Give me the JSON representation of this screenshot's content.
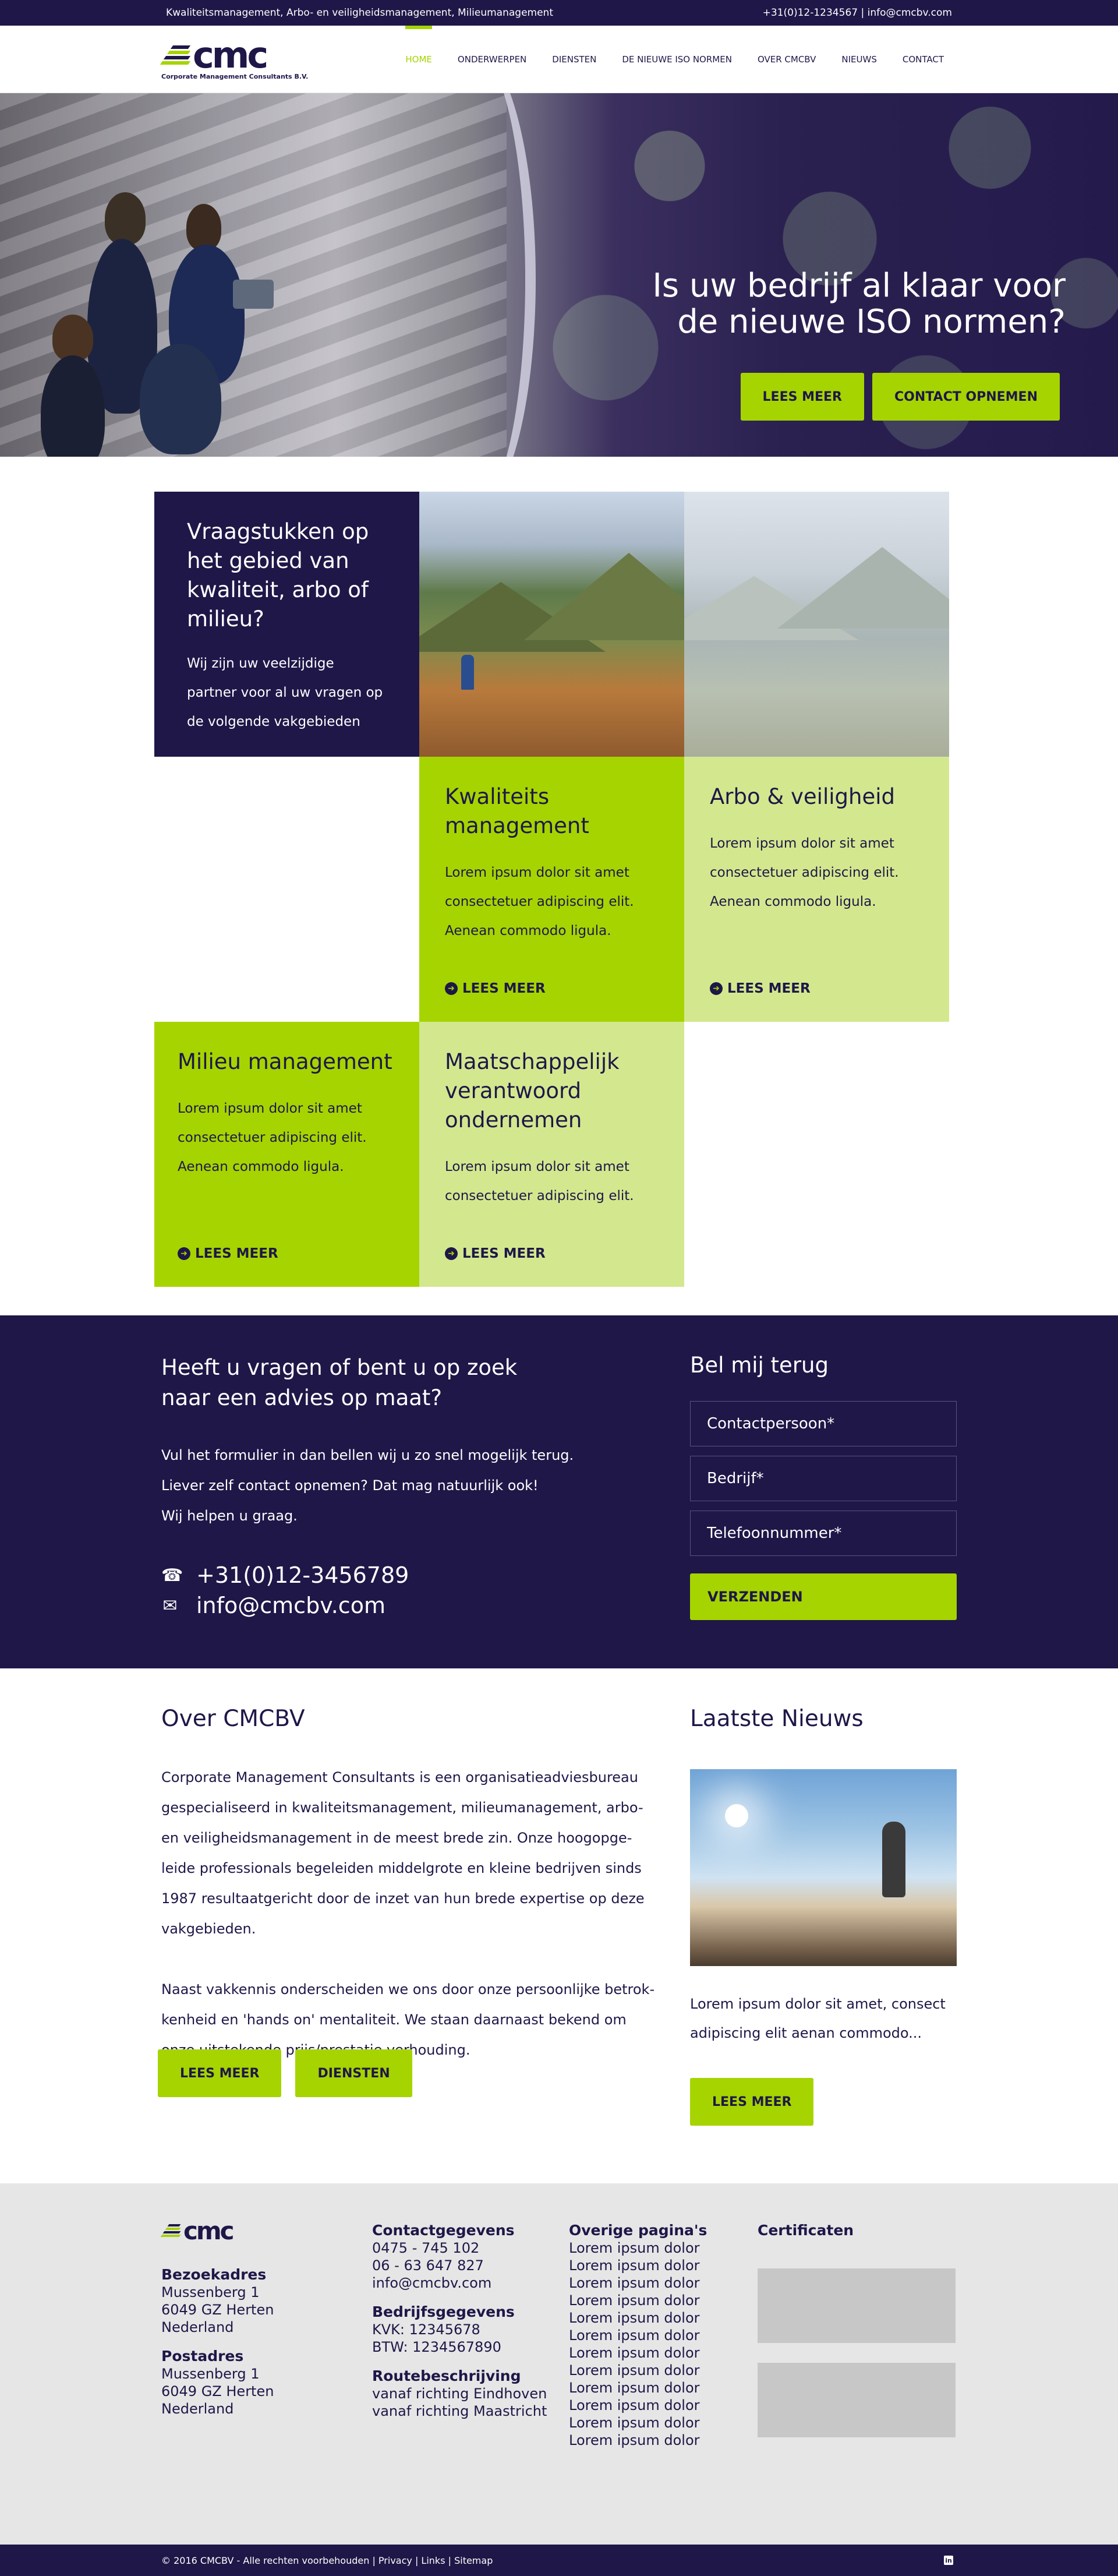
{
  "topbar": {
    "tagline": "Kwaliteitsmanagement, Arbo- en veiligheidsmanagement, Milieumanagement",
    "contact": "+31(0)12-1234567 | info@cmcbv.com"
  },
  "logo": {
    "text": "cmc",
    "subtitle": "Corporate Management Consultants B.V."
  },
  "nav": [
    "HOME",
    "ONDERWERPEN",
    "DIENSTEN",
    "DE NIEUWE ISO NORMEN",
    "OVER CMCBV",
    "NIEUWS",
    "CONTACT"
  ],
  "hero": {
    "title_line1": "Is uw bedrijf al klaar voor",
    "title_line2": "de nieuwe ISO normen?",
    "btn_more": "LEES MEER",
    "btn_contact": "CONTACT OPNEMEN"
  },
  "services": {
    "intro_title": "Vraagstukken op het gebied van kwaliteit, arbo of milieu?",
    "intro_text": "Wij zijn uw veelzijdige partner voor al uw vragen op de volgende vakgebieden",
    "more_label": "LEES MEER",
    "items": [
      {
        "title": "Kwaliteits management",
        "text": "Lorem ipsum dolor sit amet consectetuer adipiscing elit. Aenean commodo ligula."
      },
      {
        "title": "Arbo & veiligheid",
        "text": "Lorem ipsum dolor sit amet consectetuer adipiscing elit. Aenean commodo ligula."
      },
      {
        "title": "Milieu management",
        "text": "Lorem ipsum dolor sit amet consectetuer adipiscing elit. Aenean commodo ligula."
      },
      {
        "title": "Maatschappelijk verantwoord ondernemen",
        "text": "Lorem ipsum dolor sit amet consectetuer adipiscing elit."
      }
    ]
  },
  "contact": {
    "title": "Heeft u vragen of bent u op zoek naar een advies op maat?",
    "text_line1": "Vul het formulier in dan bellen wij u zo snel mogelijk terug.",
    "text_line2": "Liever zelf contact opnemen? Dat mag natuurlijk ook!",
    "text_line3": "Wij helpen u graag.",
    "phone": "+31(0)12-3456789",
    "email": "info@cmcbv.com",
    "form_title": "Bel mij terug",
    "field_person": "Contactpersoon*",
    "field_company": "Bedrijf*",
    "field_phone": "Telefoonnummer*",
    "submit": "VERZENDEN"
  },
  "about": {
    "title": "Over CMCBV",
    "paragraph1": "Corporate Management Consultants is een organisatieadviesbureau gespecialiseerd in kwaliteitsmanagement, milieumanagement, arbo- en veiligheidsmanagement in de meest brede zin. Onze hoogopge-leide professionals begeleiden middelgrote en kleine bedrijven sinds 1987 resultaatgericht door de inzet van hun brede expertise op deze vakgebieden.",
    "paragraph2": "Naast vakkennis onderscheiden we ons door onze persoonlijke betrok-kenheid en 'hands on' mentaliteit. We staan daarnaast bekend om onze uitstekende prijs/prestatie verhouding.",
    "btn_more": "LEES MEER",
    "btn_services": "DIENSTEN"
  },
  "news": {
    "title": "Laatste Nieuws",
    "text": "Lorem ipsum dolor sit amet, consect adipiscing elit aenan commodo...",
    "btn_more": "LEES MEER"
  },
  "footer": {
    "visit_title": "Bezoekadres",
    "visit_lines": [
      "Mussenberg 1",
      "6049 GZ Herten",
      "Nederland"
    ],
    "post_title": "Postadres",
    "post_lines": [
      "Mussenberg 1",
      "6049 GZ Herten",
      "Nederland"
    ],
    "contact_title": "Contactgegevens",
    "contact_lines": [
      "0475 - 745 102",
      "06 - 63 647 827",
      "info@cmcbv.com"
    ],
    "company_title": "Bedrijfsgegevens",
    "company_lines": [
      "KVK: 12345678",
      "BTW: 1234567890"
    ],
    "route_title": "Routebeschrijving",
    "route_lines": [
      "vanaf richting Eindhoven",
      "vanaf richting Maastricht"
    ],
    "other_title": "Overige pagina's",
    "other_links": [
      "Lorem ipsum dolor",
      "Lorem ipsum dolor",
      "Lorem ipsum dolor",
      "Lorem ipsum dolor",
      "Lorem ipsum dolor",
      "Lorem ipsum dolor",
      "Lorem ipsum dolor",
      "Lorem ipsum dolor",
      "Lorem ipsum dolor",
      "Lorem ipsum dolor",
      "Lorem ipsum dolor",
      "Lorem ipsum dolor"
    ],
    "cert_title": "Certificaten"
  },
  "bottombar": {
    "copyright": "© 2016 CMCBV - Alle rechten voorbehouden | Privacy | Links | Sitemap",
    "linkedin": "in"
  },
  "colors": {
    "brand_dark": "#1e1748",
    "brand_green": "#a6d400",
    "brand_light_green": "#d3e88e"
  }
}
